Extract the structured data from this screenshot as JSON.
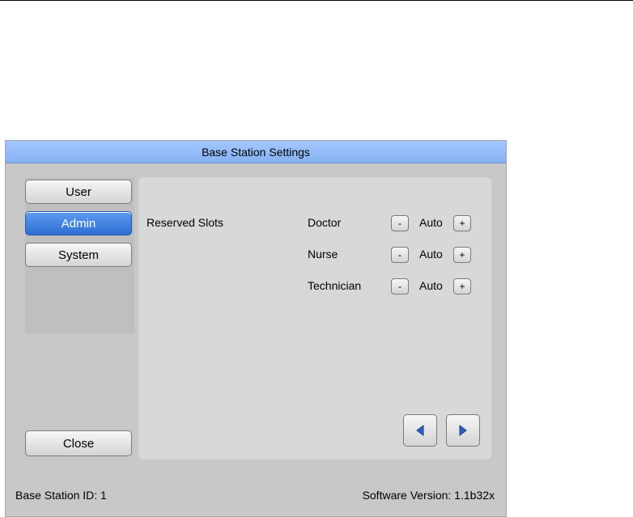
{
  "window": {
    "title": "Base Station Settings"
  },
  "sidebar": {
    "items": [
      {
        "label": "User",
        "active": false
      },
      {
        "label": "Admin",
        "active": true
      },
      {
        "label": "System",
        "active": false
      }
    ],
    "close_label": "Close"
  },
  "panel": {
    "section_label": "Reserved Slots",
    "rows": [
      {
        "role": "Doctor",
        "minus": "-",
        "value": "Auto",
        "plus": "+"
      },
      {
        "role": "Nurse",
        "minus": "-",
        "value": "Auto",
        "plus": "+"
      },
      {
        "role": "Technician",
        "minus": "-",
        "value": "Auto",
        "plus": "+"
      }
    ],
    "nav": {
      "prev_icon": "triangle-left-icon",
      "next_icon": "triangle-right-icon"
    }
  },
  "footer": {
    "base_station_id": "Base Station ID: 1",
    "software_version": "Software Version: 1.1b32x"
  },
  "colors": {
    "titlebar": "#86b0f2",
    "active_button": "#2d6fd3",
    "window_bg": "#c8c8c8",
    "panel_bg": "#d8d8d8",
    "nav_arrow": "#2a5fc4"
  }
}
